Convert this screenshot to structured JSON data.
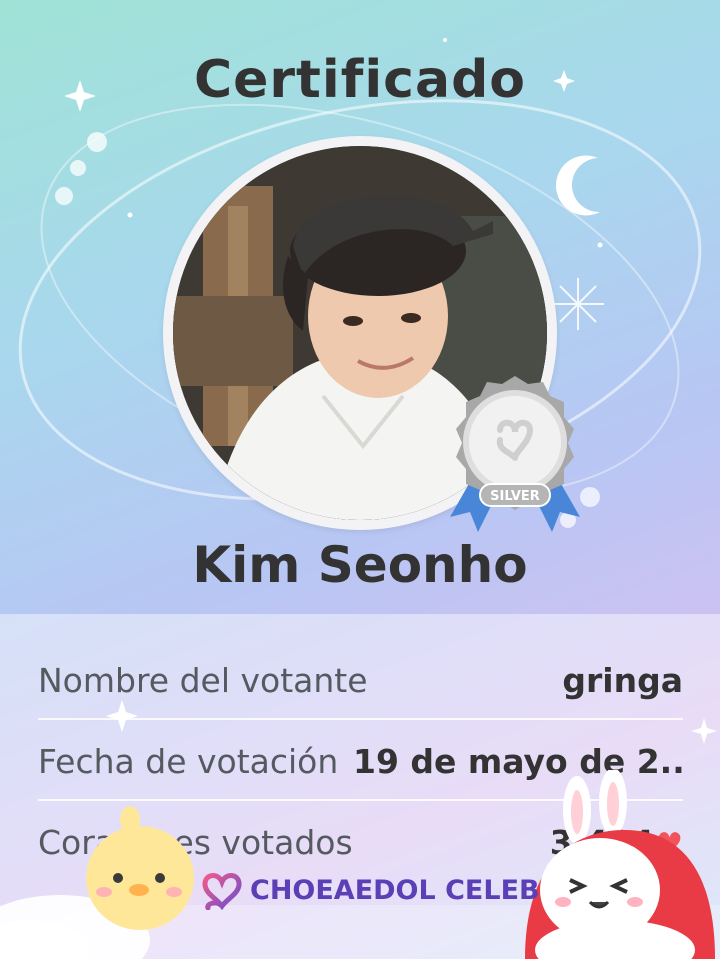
{
  "certificate": {
    "title": "Certificado",
    "celeb_name": "Kim Seonho",
    "badge_label": "SILVER"
  },
  "details": [
    {
      "label": "Nombre del votante",
      "value": "gringa"
    },
    {
      "label": "Fecha de votación",
      "value": "19 de mayo de 2..."
    },
    {
      "label": "Corazones votados",
      "value": "3,434"
    }
  ],
  "brand": {
    "name": "CHOEAEDOL CELEB"
  },
  "colors": {
    "heart": "#f2545b",
    "brand": "#5b3fb6",
    "medal_ribbon": "#4a86d8",
    "title_text": "#333333"
  },
  "icons": [
    "sparkle-icon",
    "moon-icon",
    "heart-icon",
    "brand-logo-icon",
    "silver-medal-icon"
  ]
}
